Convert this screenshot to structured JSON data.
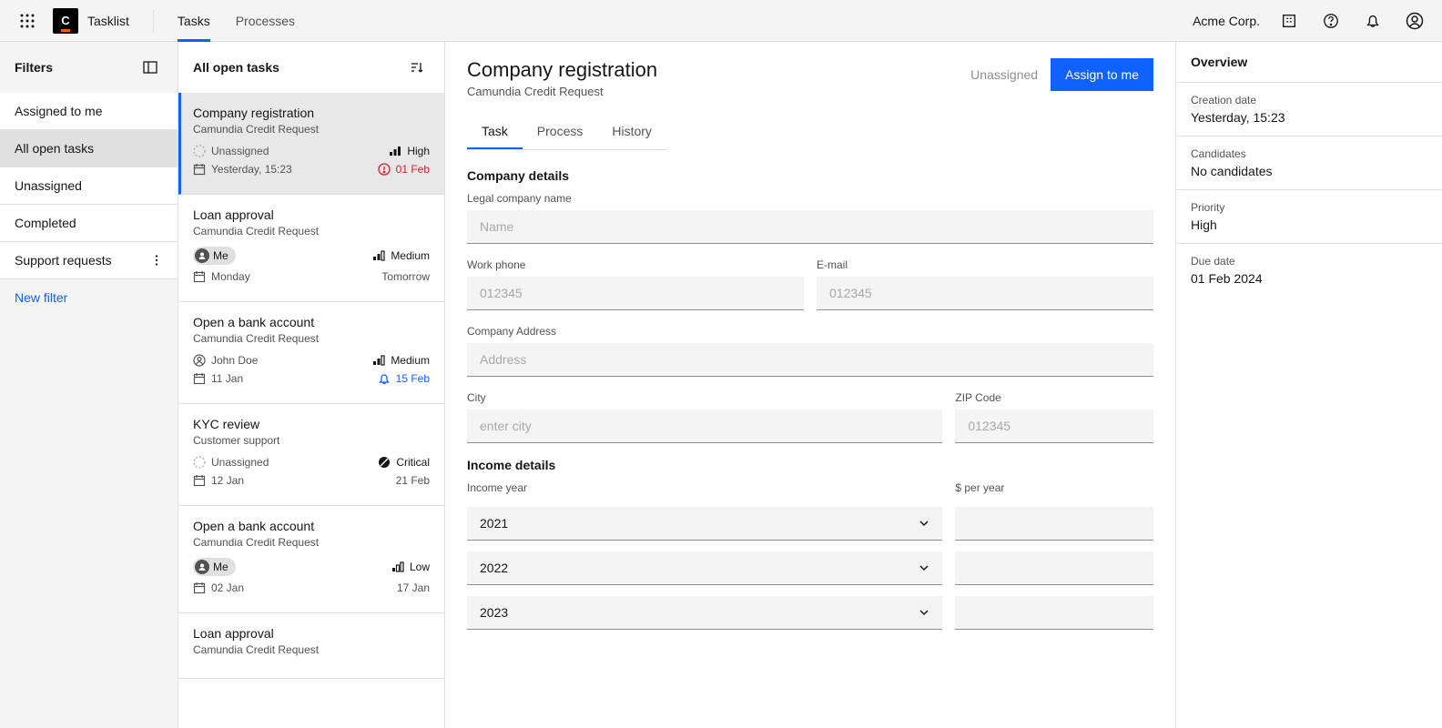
{
  "topbar": {
    "app_name": "Tasklist",
    "nav": {
      "tasks": "Tasks",
      "processes": "Processes"
    },
    "org": "Acme Corp."
  },
  "filters": {
    "title": "Filters",
    "items": [
      {
        "label": "Assigned to me"
      },
      {
        "label": "All open tasks"
      },
      {
        "label": "Unassigned"
      },
      {
        "label": "Completed"
      },
      {
        "label": "Support requests"
      }
    ],
    "new_filter": "New filter"
  },
  "tasklist": {
    "title": "All open tasks",
    "items": [
      {
        "title": "Company registration",
        "sub": "Camundia Credit Request",
        "assignee": "Unassigned",
        "priority": "High",
        "date": "Yesterday, 15:23",
        "due": "01 Feb"
      },
      {
        "title": "Loan approval",
        "sub": "Camundia Credit Request",
        "assignee": "Me",
        "priority": "Medium",
        "date": "Monday",
        "due": "Tomorrow"
      },
      {
        "title": "Open a bank account",
        "sub": "Camundia Credit Request",
        "assignee": "John Doe",
        "priority": "Medium",
        "date": "11 Jan",
        "due": "15 Feb"
      },
      {
        "title": "KYC review",
        "sub": "Customer support",
        "assignee": "Unassigned",
        "priority": "Critical",
        "date": "12 Jan",
        "due": "21 Feb"
      },
      {
        "title": "Open a bank account",
        "sub": "Camundia Credit Request",
        "assignee": "Me",
        "priority": "Low",
        "date": "02 Jan",
        "due": "17 Jan"
      },
      {
        "title": "Loan approval",
        "sub": "Camundia Credit Request",
        "assignee": "",
        "priority": "",
        "date": "",
        "due": ""
      }
    ]
  },
  "detail": {
    "title": "Company registration",
    "sub": "Camundia Credit Request",
    "unassigned": "Unassigned",
    "assign_btn": "Assign to me",
    "tabs": {
      "task": "Task",
      "process": "Process",
      "history": "History"
    },
    "company": {
      "heading": "Company details",
      "legal_name_label": "Legal company name",
      "legal_name_ph": "Name",
      "work_phone_label": "Work phone",
      "work_phone_ph": "012345",
      "email_label": "E-mail",
      "email_ph": "012345",
      "address_label": "Company Address",
      "address_ph": "Address",
      "city_label": "City",
      "city_ph": "enter city",
      "zip_label": "ZIP Code",
      "zip_ph": "012345"
    },
    "income": {
      "heading": "Income details",
      "year_label": "Income year",
      "per_year_label": "$ per year",
      "years": [
        "2021",
        "2022",
        "2023"
      ]
    }
  },
  "overview": {
    "title": "Overview",
    "creation_label": "Creation date",
    "creation_value": "Yesterday, 15:23",
    "candidates_label": "Candidates",
    "candidates_value": "No candidates",
    "priority_label": "Priority",
    "priority_value": "High",
    "due_label": "Due date",
    "due_value": "01 Feb 2024"
  }
}
